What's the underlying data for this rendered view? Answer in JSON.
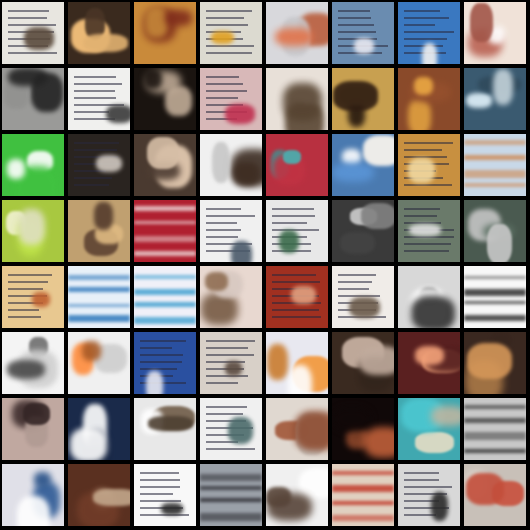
{
  "grid": {
    "rows": 8,
    "cols": 8,
    "background": "#000000",
    "tiles": [
      {
        "bg": "#e8e6e0",
        "accent": "#5a4a3c",
        "style": "doc"
      },
      {
        "bg": "#3a2a1e",
        "accent": "#e0b070",
        "style": "blob"
      },
      {
        "bg": "#c98a3a",
        "accent": "#7a2a1a",
        "style": "blob"
      },
      {
        "bg": "#dcdad0",
        "accent": "#e0a020",
        "style": "doc"
      },
      {
        "bg": "#d8d8dc",
        "accent": "#b05a3a",
        "style": "blob"
      },
      {
        "bg": "#6a8cb0",
        "accent": "#e8e8f0",
        "style": "doc"
      },
      {
        "bg": "#3a78c0",
        "accent": "#f0f0f0",
        "style": "doc"
      },
      {
        "bg": "#f0e2d8",
        "accent": "#c86a5a",
        "style": "blob"
      },
      {
        "bg": "#9a9a98",
        "accent": "#2a2a2a",
        "style": "blob"
      },
      {
        "bg": "#f0f0ee",
        "accent": "#3a3a3a",
        "style": "doc"
      },
      {
        "bg": "#1a1410",
        "accent": "#e0c8b0",
        "style": "blob"
      },
      {
        "bg": "#d8b8b8",
        "accent": "#c03050",
        "style": "doc"
      },
      {
        "bg": "#e8e0d8",
        "accent": "#4a3a2a",
        "style": "blob"
      },
      {
        "bg": "#c8a050",
        "accent": "#2a1a10",
        "style": "blob"
      },
      {
        "bg": "#8a4a2a",
        "accent": "#e0a040",
        "style": "blob"
      },
      {
        "bg": "#3a5a70",
        "accent": "#d0e0e8",
        "style": "blob"
      },
      {
        "bg": "#40c040",
        "accent": "#e8e8e8",
        "style": "blob"
      },
      {
        "bg": "#2a2420",
        "accent": "#d0c8c0",
        "style": "doc"
      },
      {
        "bg": "#4a3a30",
        "accent": "#d8c0a8",
        "style": "blob"
      },
      {
        "bg": "#f0f0f0",
        "accent": "#3a2a20",
        "style": "blob"
      },
      {
        "bg": "#b83040",
        "accent": "#40a0a0",
        "style": "blob"
      },
      {
        "bg": "#4a7ab0",
        "accent": "#e8e0d8",
        "style": "blob"
      },
      {
        "bg": "#c89040",
        "accent": "#f0d8a0",
        "style": "doc"
      },
      {
        "bg": "#c8d8e8",
        "accent": "#d08040",
        "style": "band"
      },
      {
        "bg": "#a8c840",
        "accent": "#f0f0d0",
        "style": "blob"
      },
      {
        "bg": "#c0a070",
        "accent": "#5a4030",
        "style": "blob"
      },
      {
        "bg": "#b02030",
        "accent": "#f0e0e0",
        "style": "band"
      },
      {
        "bg": "#f0f0f0",
        "accent": "#4a5a6a",
        "style": "doc"
      },
      {
        "bg": "#e8e8e8",
        "accent": "#3a6a4a",
        "style": "doc"
      },
      {
        "bg": "#3a3a3a",
        "accent": "#a0a0a0",
        "style": "blob"
      },
      {
        "bg": "#6a7a6a",
        "accent": "#e0e0e0",
        "style": "doc"
      },
      {
        "bg": "#4a5a50",
        "accent": "#e8e8e8",
        "style": "blob"
      },
      {
        "bg": "#e8c890",
        "accent": "#c06030",
        "style": "doc"
      },
      {
        "bg": "#e8f0f8",
        "accent": "#3a80c0",
        "style": "band"
      },
      {
        "bg": "#f0f0f8",
        "accent": "#40a0d0",
        "style": "band"
      },
      {
        "bg": "#e8d8d0",
        "accent": "#8a6a50",
        "style": "blob"
      },
      {
        "bg": "#a03020",
        "accent": "#e0a080",
        "style": "doc"
      },
      {
        "bg": "#f0ece8",
        "accent": "#6a5a4a",
        "style": "doc"
      },
      {
        "bg": "#d8d8d8",
        "accent": "#2a2a2a",
        "style": "blob"
      },
      {
        "bg": "#f8f8f8",
        "accent": "#3a3a3a",
        "style": "band"
      },
      {
        "bg": "#f4f4f4",
        "accent": "#5a5a5a",
        "style": "blob"
      },
      {
        "bg": "#f0f0f0",
        "accent": "#d07030",
        "style": "blob"
      },
      {
        "bg": "#2a50a0",
        "accent": "#e8e8f0",
        "style": "doc"
      },
      {
        "bg": "#d8d0c8",
        "accent": "#5a4a40",
        "style": "doc"
      },
      {
        "bg": "#e8e8f0",
        "accent": "#d08030",
        "style": "blob"
      },
      {
        "bg": "#3a2a20",
        "accent": "#d8c0b0",
        "style": "blob"
      },
      {
        "bg": "#5a2020",
        "accent": "#c08060",
        "style": "blob"
      },
      {
        "bg": "#3a2820",
        "accent": "#c08850",
        "style": "blob"
      },
      {
        "bg": "#c0a8a0",
        "accent": "#3a2a2a",
        "style": "blob"
      },
      {
        "bg": "#1a2a4a",
        "accent": "#e0e0e8",
        "style": "blob"
      },
      {
        "bg": "#e8e8e8",
        "accent": "#5a4a3a",
        "style": "blob"
      },
      {
        "bg": "#f0f0f0",
        "accent": "#4a6a6a",
        "style": "doc"
      },
      {
        "bg": "#e0d8d0",
        "accent": "#8a4a30",
        "style": "blob"
      },
      {
        "bg": "#100808",
        "accent": "#a05030",
        "style": "blob"
      },
      {
        "bg": "#40a8b0",
        "accent": "#e0d8c0",
        "style": "blob"
      },
      {
        "bg": "#c8c8c8",
        "accent": "#3a3a3a",
        "style": "band"
      },
      {
        "bg": "#e0e0e8",
        "accent": "#3060a0",
        "style": "blob"
      },
      {
        "bg": "#5a3020",
        "accent": "#e0c0a0",
        "style": "blob"
      },
      {
        "bg": "#f8f8f8",
        "accent": "#2a2a2a",
        "style": "doc"
      },
      {
        "bg": "#9aa0a8",
        "accent": "#2a2a30",
        "style": "band"
      },
      {
        "bg": "#f0f0f0",
        "accent": "#4a3a30",
        "style": "blob"
      },
      {
        "bg": "#e0d0c0",
        "accent": "#c03020",
        "style": "band"
      },
      {
        "bg": "#d8d8d8",
        "accent": "#2a2a2a",
        "style": "doc"
      },
      {
        "bg": "#c8c0b8",
        "accent": "#a04030",
        "style": "blob"
      }
    ]
  }
}
